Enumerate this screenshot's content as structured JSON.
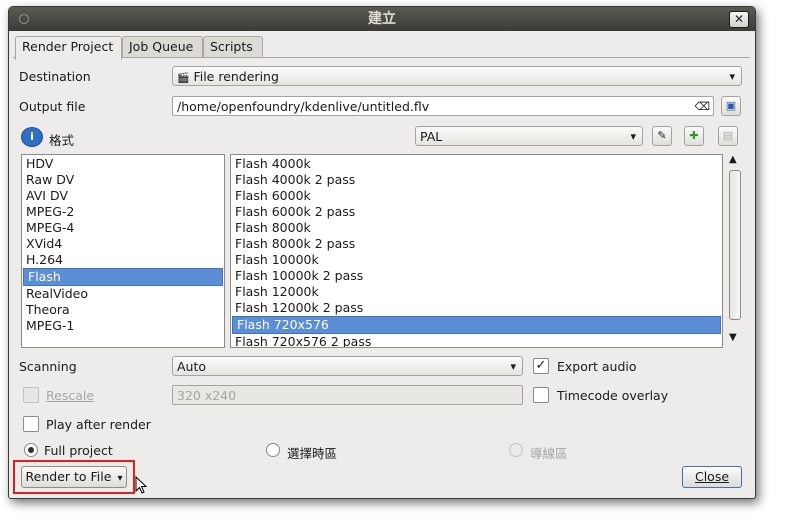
{
  "window": {
    "title": "建立"
  },
  "tabs": [
    {
      "label": "Render Project"
    },
    {
      "label": "Job Queue"
    },
    {
      "label": "Scripts"
    }
  ],
  "destination": {
    "label": "Destination",
    "value": "File rendering"
  },
  "output_file": {
    "label": "Output file",
    "value": "/home/openfoundry/kdenlive/untitled.flv"
  },
  "format": {
    "label": "格式",
    "profile": "PAL"
  },
  "format_list": [
    "HDV",
    "Raw DV",
    "AVI DV",
    "MPEG-2",
    "MPEG-4",
    "XVid4",
    "H.264",
    "Flash",
    "RealVideo",
    "Theora",
    "MPEG-1"
  ],
  "format_selected": "Flash",
  "preset_list": [
    "Flash 4000k",
    "Flash 4000k 2 pass",
    "Flash 6000k",
    "Flash 6000k 2 pass",
    "Flash 8000k",
    "Flash 8000k 2 pass",
    "Flash 10000k",
    "Flash 10000k 2 pass",
    "Flash 12000k",
    "Flash 12000k 2 pass",
    "Flash 720x576",
    "Flash 720x576 2 pass"
  ],
  "preset_selected": "Flash 720x576",
  "scanning": {
    "label": "Scanning",
    "value": "Auto"
  },
  "export_audio": {
    "label": "Export audio",
    "checked": true
  },
  "rescale": {
    "label": "Rescale",
    "value": "320 x240",
    "checked": false
  },
  "timecode_overlay": {
    "label": "Timecode overlay",
    "checked": false
  },
  "play_after_render": {
    "label": "Play after render",
    "checked": false
  },
  "range": {
    "full_project": "Full project",
    "selected_zone": "選擇時區",
    "guide_zone": "導線區",
    "selected": "Full project"
  },
  "buttons": {
    "render_to_file": "Render to File",
    "close": "Close"
  },
  "colors": {
    "selection": "#5b8ed4",
    "highlight_box": "#e0201a",
    "titlebar": "#3c3b37"
  }
}
